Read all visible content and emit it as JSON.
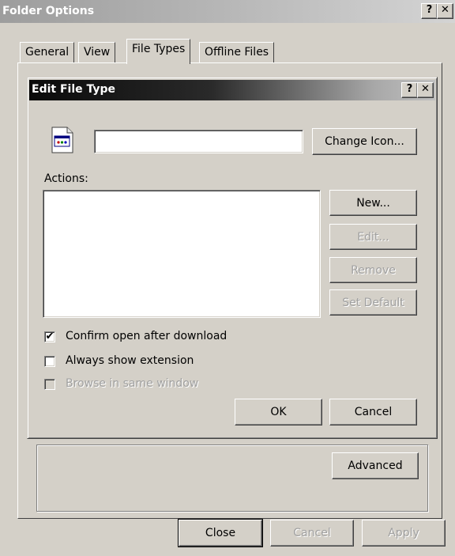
{
  "outer_window": {
    "title": "Folder Options",
    "help_glyph": "?",
    "close_glyph": "✕",
    "tabs": [
      {
        "label": "General"
      },
      {
        "label": "View"
      },
      {
        "label": "File Types"
      },
      {
        "label": "Offline Files"
      }
    ],
    "advanced_label": "Advanced",
    "close_label": "Close",
    "cancel_label": "Cancel",
    "apply_label": "Apply"
  },
  "dialog": {
    "title": "Edit File Type",
    "help_glyph": "?",
    "close_glyph": "✕",
    "type_name_value": "",
    "change_icon_label": "Change Icon...",
    "actions_label": "Actions:",
    "actions_items": [],
    "new_label": "New...",
    "edit_label": "Edit...",
    "remove_label": "Remove",
    "set_default_label": "Set Default",
    "confirm_open": {
      "label": "Confirm open after download",
      "checked": true,
      "mark": "✔"
    },
    "always_show_ext": {
      "label": "Always show extension",
      "checked": false
    },
    "browse_same_window": {
      "label": "Browse in same window",
      "checked": false,
      "disabled": true
    },
    "ok_label": "OK",
    "cancel_label": "Cancel"
  },
  "icons": {
    "file_type_icon": "document-window-icon"
  }
}
